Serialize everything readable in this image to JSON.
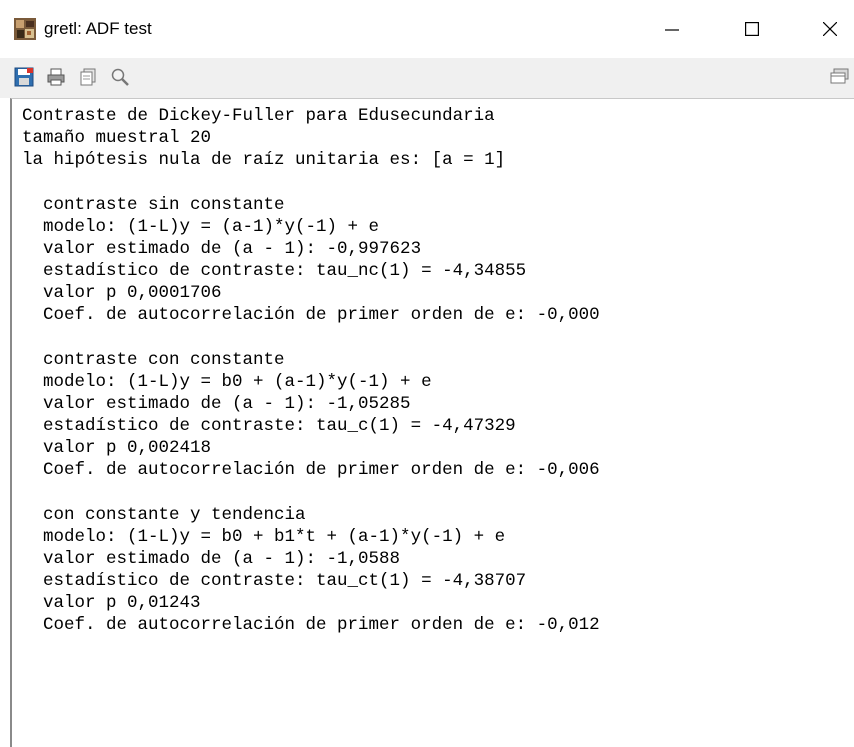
{
  "window": {
    "title": "gretl: ADF test",
    "app_icon": "gretl-icon",
    "controls": [
      "minimize-icon",
      "maximize-icon",
      "close-icon"
    ]
  },
  "toolbar": {
    "buttons": [
      {
        "name": "save-icon"
      },
      {
        "name": "print-icon"
      },
      {
        "name": "copy-icon"
      },
      {
        "name": "find-icon"
      },
      {
        "name": "window-list-icon"
      }
    ]
  },
  "output": {
    "lines": [
      "Contraste de Dickey-Fuller para Edusecundaria",
      "tamaño muestral 20",
      "la hipótesis nula de raíz unitaria es: [a = 1]",
      "",
      "  contraste sin constante",
      "  modelo: (1-L)y = (a-1)*y(-1) + e",
      "  valor estimado de (a - 1): -0,997623",
      "  estadístico de contraste: tau_nc(1) = -4,34855",
      "  valor p 0,0001706",
      "  Coef. de autocorrelación de primer orden de e: -0,000",
      "",
      "  contraste con constante",
      "  modelo: (1-L)y = b0 + (a-1)*y(-1) + e",
      "  valor estimado de (a - 1): -1,05285",
      "  estadístico de contraste: tau_c(1) = -4,47329",
      "  valor p 0,002418",
      "  Coef. de autocorrelación de primer orden de e: -0,006",
      "",
      "  con constante y tendencia",
      "  modelo: (1-L)y = b0 + b1*t + (a-1)*y(-1) + e",
      "  valor estimado de (a - 1): -1,0588",
      "  estadístico de contraste: tau_ct(1) = -4,38707",
      "  valor p 0,01243",
      "  Coef. de autocorrelación de primer orden de e: -0,012"
    ]
  },
  "colors": {
    "toolbar_bg": "#f0f0f0",
    "text": "#000000",
    "content_border": "#8a8a8a"
  }
}
